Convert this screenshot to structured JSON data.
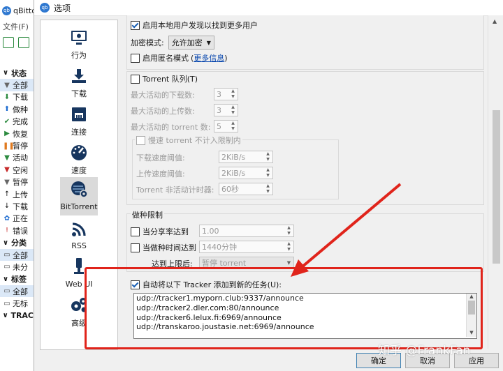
{
  "bg": {
    "title": "qBitto",
    "menu": "文件(F)",
    "items": [
      {
        "kind": "sec",
        "label": "状态"
      },
      {
        "kind": "item",
        "label": "全部",
        "sel": true,
        "icon": "filter-icon",
        "glyph": "▼",
        "color": "#666666"
      },
      {
        "kind": "item",
        "label": "下载",
        "icon": "download-arrow-icon",
        "glyph": "⬇",
        "color": "#2b8a3e"
      },
      {
        "kind": "item",
        "label": "做种",
        "icon": "upload-arrow-icon",
        "glyph": "⬆",
        "color": "#1c6bd0"
      },
      {
        "kind": "item",
        "label": "完成",
        "icon": "check-icon",
        "glyph": "✔",
        "color": "#2b8a3e"
      },
      {
        "kind": "item",
        "label": "恢复",
        "icon": "play-icon",
        "glyph": "▶",
        "color": "#2b8a3e"
      },
      {
        "kind": "item",
        "label": "暂停",
        "icon": "pause-icon",
        "glyph": "❚❚",
        "color": "#e07a1f"
      },
      {
        "kind": "item",
        "label": "活动",
        "icon": "filter-active-icon",
        "glyph": "▼",
        "color": "#2b8a3e"
      },
      {
        "kind": "item",
        "label": "空闲",
        "icon": "filter-inactive-icon",
        "glyph": "▼",
        "color": "#c62828"
      },
      {
        "kind": "item",
        "label": "暂停",
        "icon": "filter-paused-icon",
        "glyph": "▼",
        "color": "#666666"
      },
      {
        "kind": "item",
        "label": "上传",
        "icon": "up-icon",
        "glyph": "↑",
        "color": "#111111"
      },
      {
        "kind": "item",
        "label": "下载",
        "icon": "down-icon",
        "glyph": "↓",
        "color": "#111111"
      },
      {
        "kind": "item",
        "label": "正在",
        "icon": "gear-icon",
        "glyph": "✿",
        "color": "#1c6bd0"
      },
      {
        "kind": "item",
        "label": "错误",
        "icon": "error-icon",
        "glyph": "!",
        "color": "#c62828"
      },
      {
        "kind": "sec",
        "label": "分类"
      },
      {
        "kind": "item",
        "label": "全部",
        "sel": true,
        "icon": "folder-icon",
        "glyph": "▭",
        "color": "#555555"
      },
      {
        "kind": "item",
        "label": "未分",
        "icon": "folder-icon",
        "glyph": "▭",
        "color": "#555555"
      },
      {
        "kind": "sec",
        "label": "标签"
      },
      {
        "kind": "item",
        "label": "全部",
        "sel": true,
        "icon": "folder-icon",
        "glyph": "▭",
        "color": "#555555"
      },
      {
        "kind": "item",
        "label": "无标",
        "icon": "folder-icon",
        "glyph": "▭",
        "color": "#555555"
      },
      {
        "kind": "sec",
        "label": "TRAC"
      }
    ]
  },
  "dialog": {
    "title": "选项",
    "categories": [
      "行为",
      "下载",
      "连接",
      "速度",
      "BitTorrent",
      "RSS",
      "Web UI",
      "高级"
    ],
    "privacy": {
      "lsd_label": "启用本地用户发现以找到更多用户",
      "encryption_label": "加密模式:",
      "encryption_value": "允许加密",
      "anon_label": "启用匿名模式",
      "anon_link": "更多信息",
      "anon_open": "(",
      "anon_close": ")"
    },
    "queue": {
      "label": "Torrent 队列(T)",
      "max_dl_label": "最大活动的下载数:",
      "max_dl": "3",
      "max_ul_label": "最大活动的上传数:",
      "max_ul": "3",
      "max_torrents_label": "最大活动的 torrent 数:",
      "max_torrents": "5",
      "slow_label": "慢速 torrent 不计入限制内",
      "dl_thresh_label": "下载速度阈值:",
      "dl_thresh": "2KiB/s",
      "ul_thresh_label": "上传速度阈值:",
      "ul_thresh": "2KiB/s",
      "timer_label": "Torrent 非活动计时器:",
      "timer": "60秒"
    },
    "seeding": {
      "title": "做种限制",
      "ratio_label": "当分享率达到",
      "ratio": "1.00",
      "time_label": "当做种时间达到",
      "time": "1440分钟",
      "then_label": "达到上限后:",
      "then_value": "暂停 torrent"
    },
    "trackers": {
      "label": "自动将以下 Tracker 添加到新的任务(U):",
      "lines": [
        "udp://tracker1.myporn.club:9337/announce",
        "udp://tracker2.dler.com:80/announce",
        "udp://tracker6.lelux.fi:6969/announce",
        "udp://transkaroo.joustasie.net:6969/announce"
      ]
    },
    "buttons": {
      "ok": "确定",
      "cancel": "取消",
      "apply": "应用"
    }
  },
  "watermark": "知乎 @FrankFan",
  "highlight_color": "#e0241b"
}
